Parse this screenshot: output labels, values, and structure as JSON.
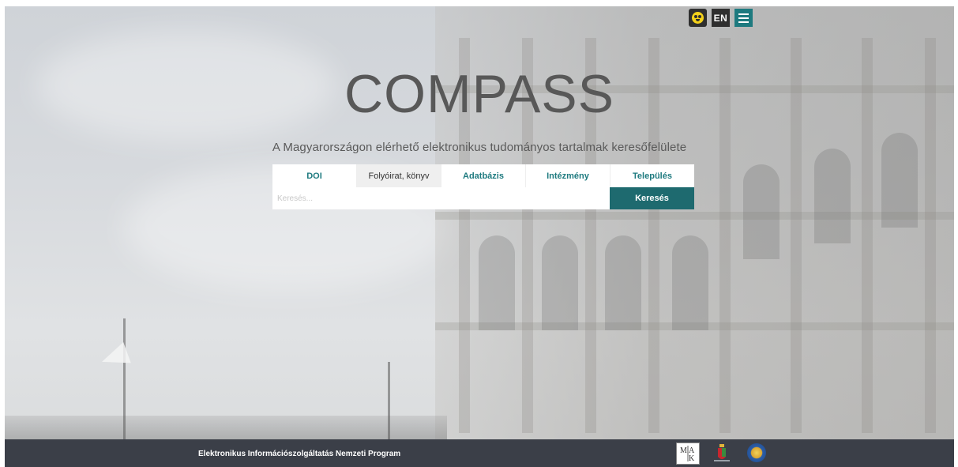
{
  "controls": {
    "accessibility_icon": "accessibility-eye-icon",
    "language_label": "EN",
    "menu_icon": "hamburger-menu-icon"
  },
  "hero": {
    "title": "COMPASS",
    "subtitle": "A Magyarországon elérhető elektronikus tudományos tartalmak keresőfelülete"
  },
  "search": {
    "tabs": [
      {
        "label": "DOI",
        "active": false
      },
      {
        "label": "Folyóirat, könyv",
        "active": true
      },
      {
        "label": "Adatbázis",
        "active": false
      },
      {
        "label": "Intézmény",
        "active": false
      },
      {
        "label": "Település",
        "active": false
      }
    ],
    "placeholder": "Keresés...",
    "value": "",
    "button_label": "Keresés"
  },
  "footer": {
    "text": "Elektronikus Információszolgáltatás Nemzeti Program",
    "logos": [
      "mtak-logo",
      "hungary-coat-of-arms-logo",
      "seal-logo"
    ]
  },
  "colors": {
    "accent": "#1e7a7f",
    "button": "#1e6a6f",
    "footer": "#3b3f48",
    "accessibility": "#f5d21b"
  }
}
